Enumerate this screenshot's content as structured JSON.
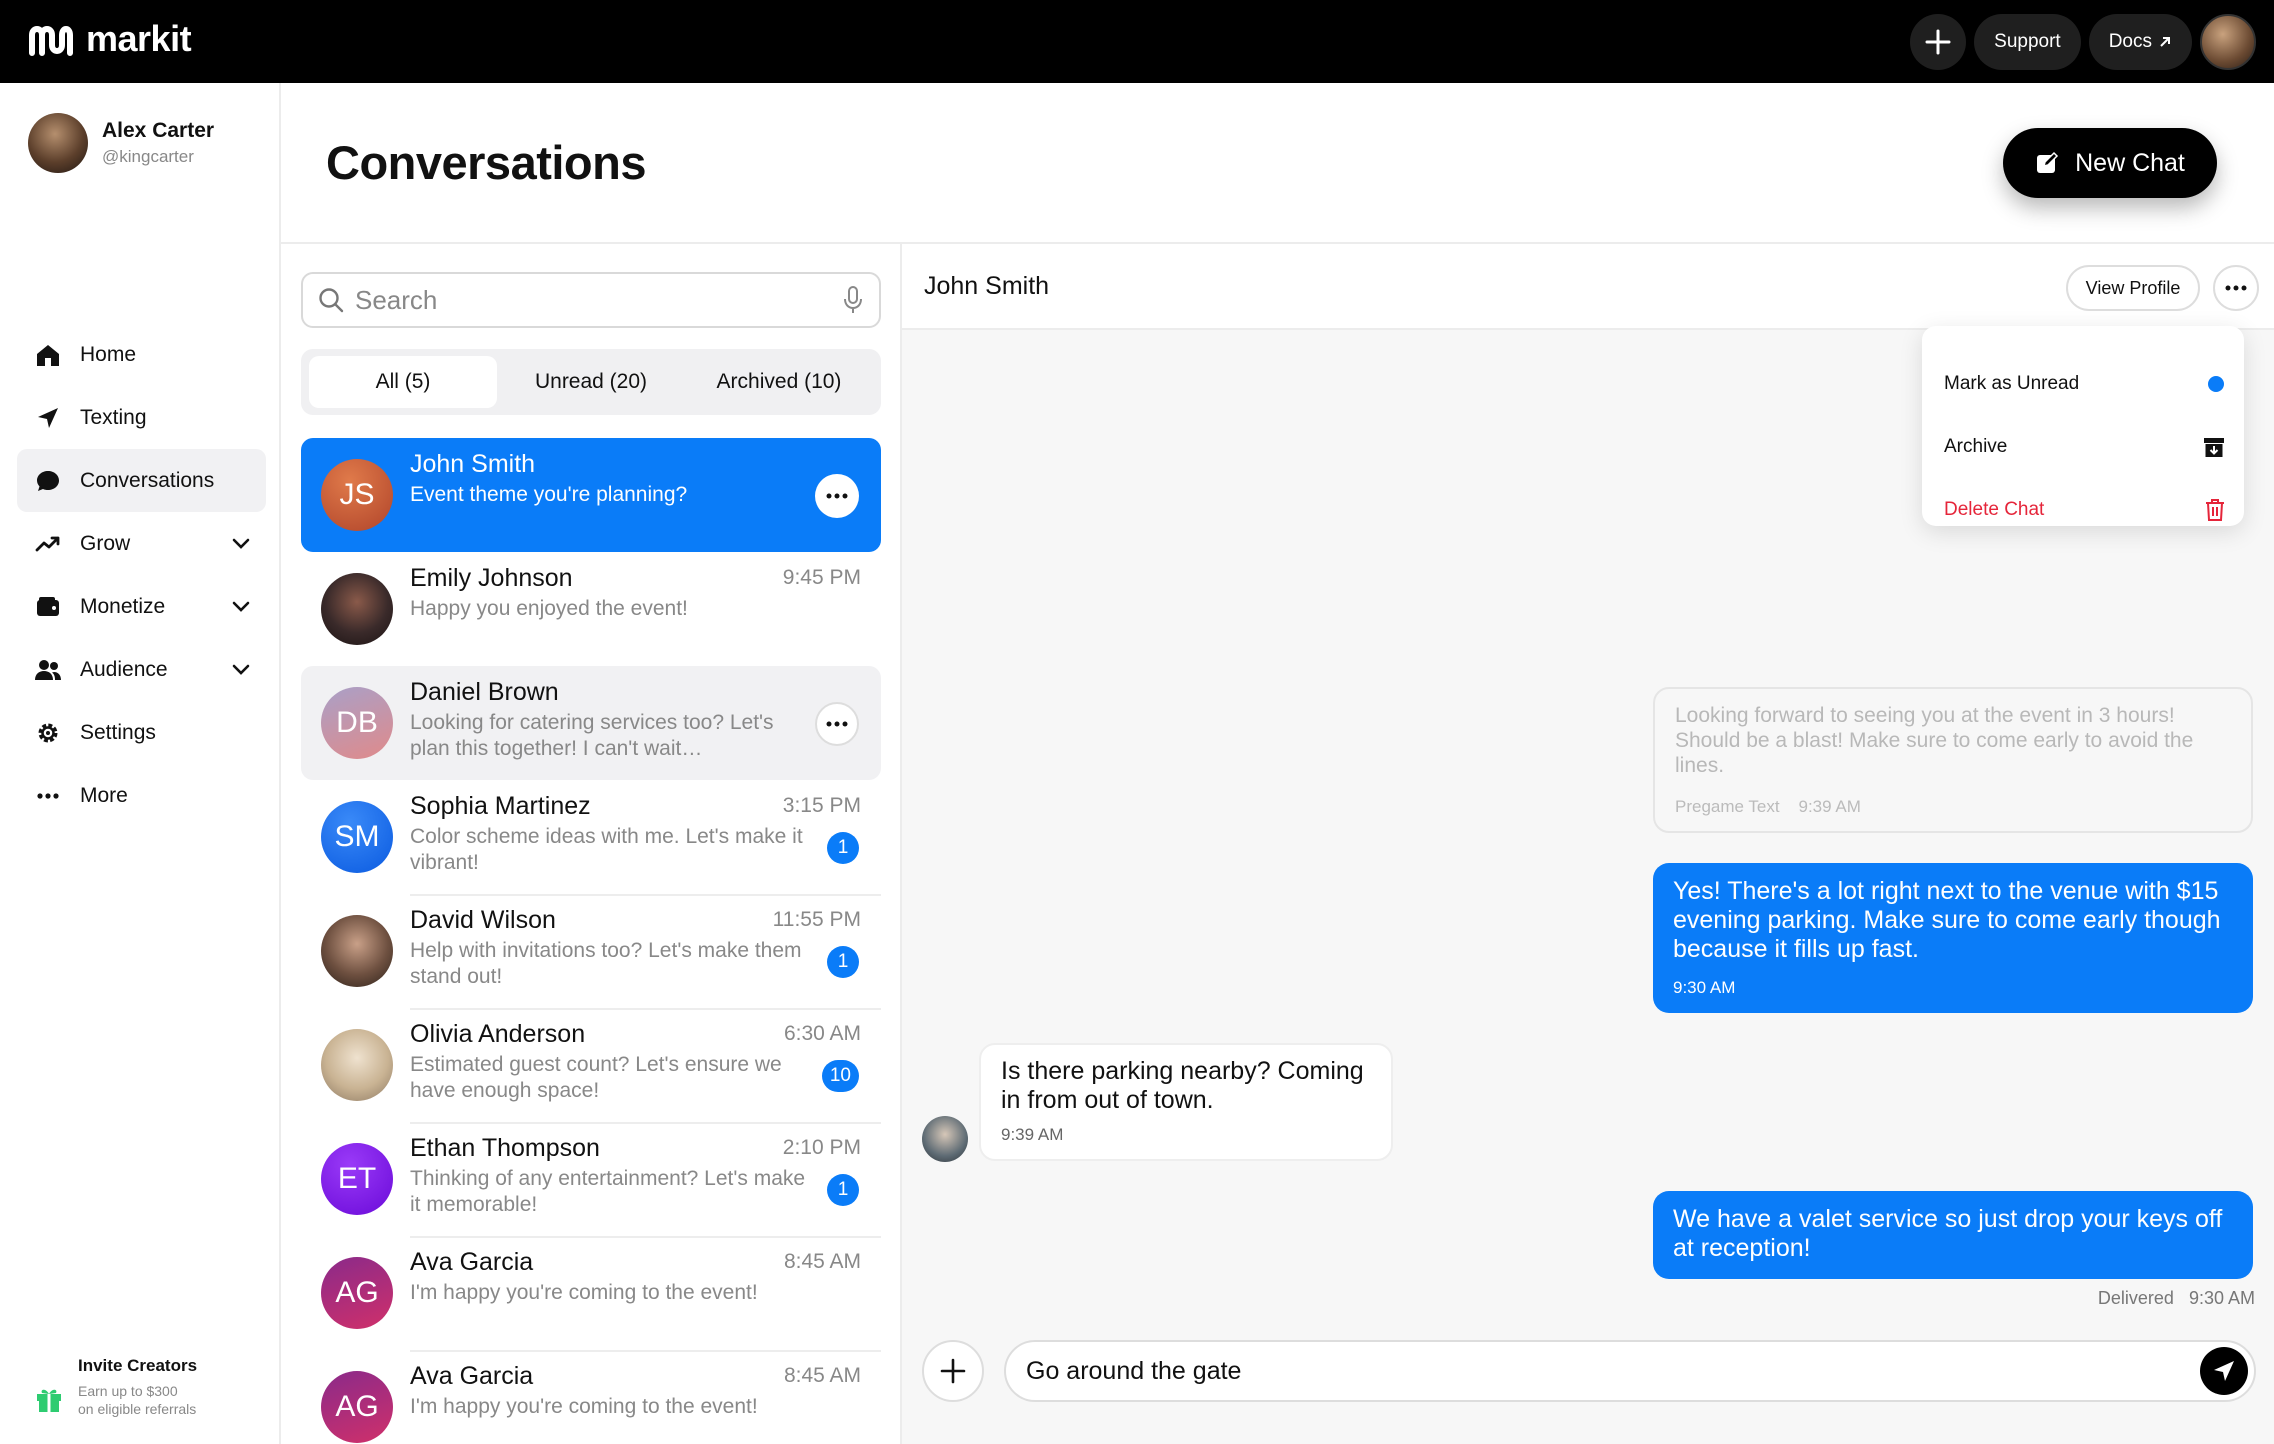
{
  "app": {
    "name": "markit"
  },
  "topbar": {
    "support_label": "Support",
    "docs_label": "Docs"
  },
  "user": {
    "name": "Alex Carter",
    "handle": "@kingcarter"
  },
  "nav": {
    "items": [
      {
        "label": "Home",
        "icon": "home-icon"
      },
      {
        "label": "Texting",
        "icon": "send-icon"
      },
      {
        "label": "Conversations",
        "icon": "chat-bubble-icon",
        "active": true
      },
      {
        "label": "Grow",
        "icon": "trending-up-icon",
        "expandable": true
      },
      {
        "label": "Monetize",
        "icon": "wallet-icon",
        "expandable": true
      },
      {
        "label": "Audience",
        "icon": "users-icon",
        "expandable": true
      },
      {
        "label": "Settings",
        "icon": "gear-icon"
      },
      {
        "label": "More",
        "icon": "more-dots-icon"
      }
    ]
  },
  "invite": {
    "title": "Invite Creators",
    "line1": "Earn up to $300",
    "line2": "on eligible referrals"
  },
  "page": {
    "title": "Conversations",
    "new_chat_label": "New Chat"
  },
  "search": {
    "placeholder": "Search"
  },
  "tabs": [
    {
      "label": "All (5)",
      "active": true
    },
    {
      "label": "Unread (20)"
    },
    {
      "label": "Archived (10)"
    }
  ],
  "conversations": [
    {
      "name": "John Smith",
      "initials": "JS",
      "preview": "Event theme you're planning?",
      "time": "",
      "badge": "",
      "state": "selected",
      "color": "#c0522e"
    },
    {
      "name": "Emily Johnson",
      "initials": "",
      "preview": "Happy you enjoyed the event!",
      "time": "9:45 PM",
      "badge": "",
      "state": "",
      "color": "#3a2a2a"
    },
    {
      "name": "Daniel Brown",
      "initials": "DB",
      "preview": "Looking for catering services too? Let's plan this together! I can't wait…",
      "time": "",
      "badge": "",
      "state": "hover",
      "color": "#c98a9a"
    },
    {
      "name": "Sophia Martinez",
      "initials": "SM",
      "preview": "Color scheme ideas with me. Let's make it vibrant!",
      "time": "3:15 PM",
      "badge": "1",
      "state": "",
      "color": "#1a6ff0"
    },
    {
      "name": "David Wilson",
      "initials": "",
      "preview": "Help with invitations too? Let's make them stand out!",
      "time": "11:55 PM",
      "badge": "1",
      "state": "",
      "color": "#5b4636"
    },
    {
      "name": "Olivia Anderson",
      "initials": "",
      "preview": "Estimated guest count? Let's ensure we have enough space!",
      "time": "6:30 AM",
      "badge": "10",
      "state": "",
      "color": "#c9b9a6"
    },
    {
      "name": "Ethan Thompson",
      "initials": "ET",
      "preview": "Thinking of any entertainment? Let's make it memorable!",
      "time": "2:10 PM",
      "badge": "1",
      "state": "",
      "color": "#7a1fe0"
    },
    {
      "name": "Ava Garcia",
      "initials": "AG",
      "preview": "I'm happy you're coming to the event!",
      "time": "8:45 AM",
      "badge": "",
      "state": "",
      "color": "#b02a6e"
    },
    {
      "name": "Ava Garcia",
      "initials": "AG",
      "preview": "I'm happy you're coming to the event!",
      "time": "8:45 AM",
      "badge": "",
      "state": "",
      "color": "#b02a6e"
    }
  ],
  "chat": {
    "title": "John Smith",
    "view_profile_label": "View Profile",
    "menu": {
      "mark_unread": "Mark as Unread",
      "archive": "Archive",
      "delete": "Delete Chat"
    },
    "pregame": {
      "text": "Looking forward to seeing you at the event in 3 hours! Should be a blast!  Make sure to come early to avoid the lines.",
      "label": "Pregame Text",
      "time": "9:39 AM"
    },
    "outgoing1": {
      "text": "Yes!  There's a lot right next to the venue with $15 evening parking.  Make sure to come early though because it fills up fast.",
      "time": "9:30 AM"
    },
    "incoming1": {
      "text": "Is there parking nearby? Coming in from out of town.",
      "time": "9:39 AM"
    },
    "outgoing2": {
      "text": "We have a valet service so just drop your keys off at reception!"
    },
    "delivered": {
      "label": "Delivered",
      "time": "9:30 AM"
    },
    "composer": {
      "value": "Go around the gate"
    }
  },
  "colors": {
    "accent": "#0a7cf8",
    "danger": "#e5253a",
    "topbar": "#000000"
  }
}
